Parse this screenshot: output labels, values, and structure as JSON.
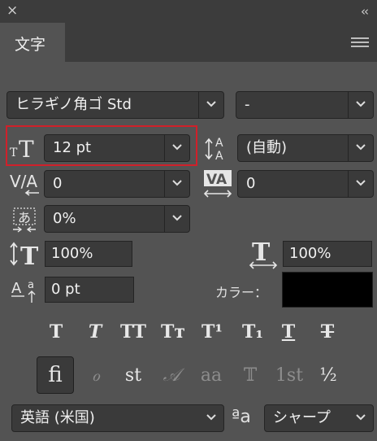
{
  "panel": {
    "close_glyph": "×",
    "collapse_glyph": "‹‹",
    "tab_label": "文字"
  },
  "font": {
    "family": "ヒラギノ角ゴ Std",
    "style": "-"
  },
  "size": {
    "value": "12 pt"
  },
  "leading": {
    "value": "(自動)"
  },
  "kerning": {
    "value": "0"
  },
  "tracking": {
    "value": "0"
  },
  "tsume": {
    "value": "0%"
  },
  "vertical_scale": {
    "value": "100%"
  },
  "horizontal_scale": {
    "value": "100%"
  },
  "baseline_shift": {
    "value": "0 pt"
  },
  "color": {
    "label": "カラー：",
    "value": "#000000"
  },
  "style_buttons": [
    {
      "glyph": "T"
    },
    {
      "glyph": "T"
    },
    {
      "glyph": "TT"
    },
    {
      "glyph": "Tт"
    },
    {
      "glyph": "T¹"
    },
    {
      "glyph": "T₁"
    },
    {
      "glyph": "T"
    },
    {
      "glyph": "T"
    }
  ],
  "feature_buttons": [
    {
      "glyph": "ﬁ"
    },
    {
      "glyph": "ℴ"
    },
    {
      "glyph": "st"
    },
    {
      "glyph": "𝒜"
    },
    {
      "glyph": "aa"
    },
    {
      "glyph": "𝕋"
    },
    {
      "glyph": "1st"
    },
    {
      "glyph": "½"
    }
  ],
  "language": {
    "value": "英語 (米国)"
  },
  "antialias": {
    "glyph": "ªa",
    "value": "シャープ"
  },
  "colors": {
    "highlight": "#d0202a",
    "panel_bg": "#535353",
    "field_bg": "#3a3a3a"
  }
}
